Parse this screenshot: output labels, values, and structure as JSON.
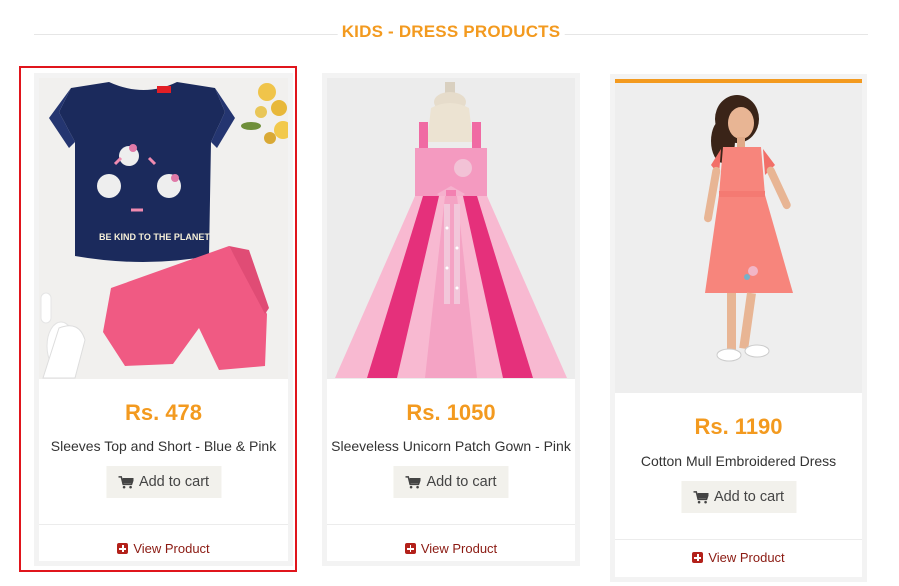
{
  "section": {
    "title": "KIDS - DRESS PRODUCTS"
  },
  "colors": {
    "accent": "#f39a1f",
    "link": "#8b1a12",
    "highlight": "#e0151c"
  },
  "products": [
    {
      "price": "Rs. 478",
      "name": "Sleeves Top and Short - Blue & Pink",
      "cart_label": "Add to cart",
      "view_label": "View Product",
      "image": "navy-top-pink-shorts",
      "highlighted": true
    },
    {
      "price": "Rs. 1050",
      "name": "Sleeveless Unicorn Patch Gown - Pink",
      "cart_label": "Add to cart",
      "view_label": "View Product",
      "image": "pink-tulle-gown"
    },
    {
      "price": "Rs. 1190",
      "name": "Cotton Mull Embroidered Dress",
      "cart_label": "Add to cart",
      "view_label": "View Product",
      "image": "girl-coral-dress",
      "active": true
    }
  ]
}
